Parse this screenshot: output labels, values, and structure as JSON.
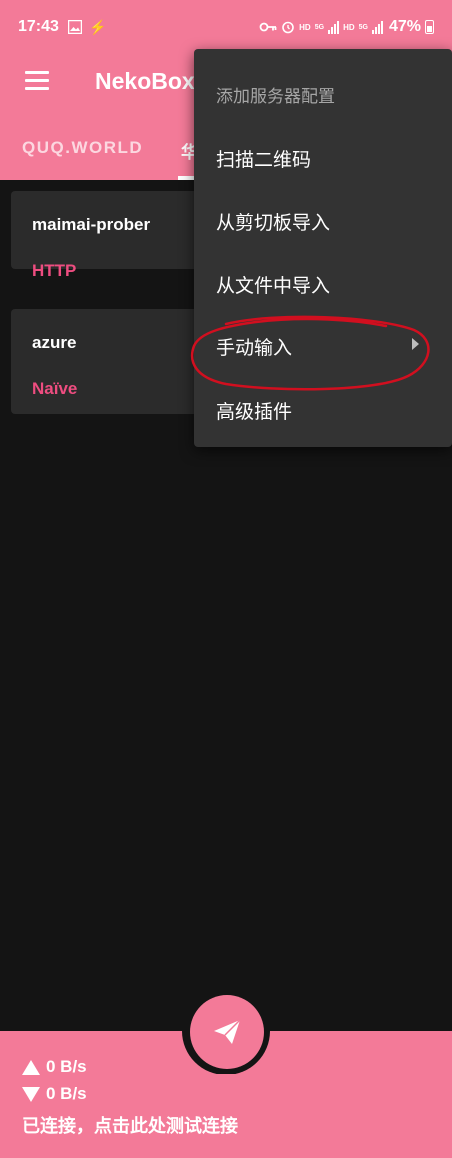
{
  "status_bar": {
    "time": "17:43",
    "hd1": "HD",
    "net1": "5G",
    "hd2": "HD",
    "net2": "5G",
    "battery": "47%"
  },
  "app": {
    "title": "NekoBox",
    "accent_color": "#f37a98",
    "type_color": "#ee4d80"
  },
  "tabs": [
    {
      "label": "QUQ.WORLD"
    },
    {
      "label": "华"
    }
  ],
  "servers": [
    {
      "name": "maimai-prober",
      "type": "HTTP"
    },
    {
      "name": "azure",
      "type": "Naïve"
    }
  ],
  "popup_menu": {
    "header": "添加服务器配置",
    "items": [
      {
        "label": "扫描二维码"
      },
      {
        "label": "从剪切板导入"
      },
      {
        "label": "从文件中导入"
      },
      {
        "label": "手动输入",
        "has_submenu": true
      },
      {
        "label": "高级插件"
      }
    ]
  },
  "bottom_bar": {
    "upload": "0 B/s",
    "download": "0 B/s",
    "status_text": "已连接，点击此处测试连接"
  }
}
